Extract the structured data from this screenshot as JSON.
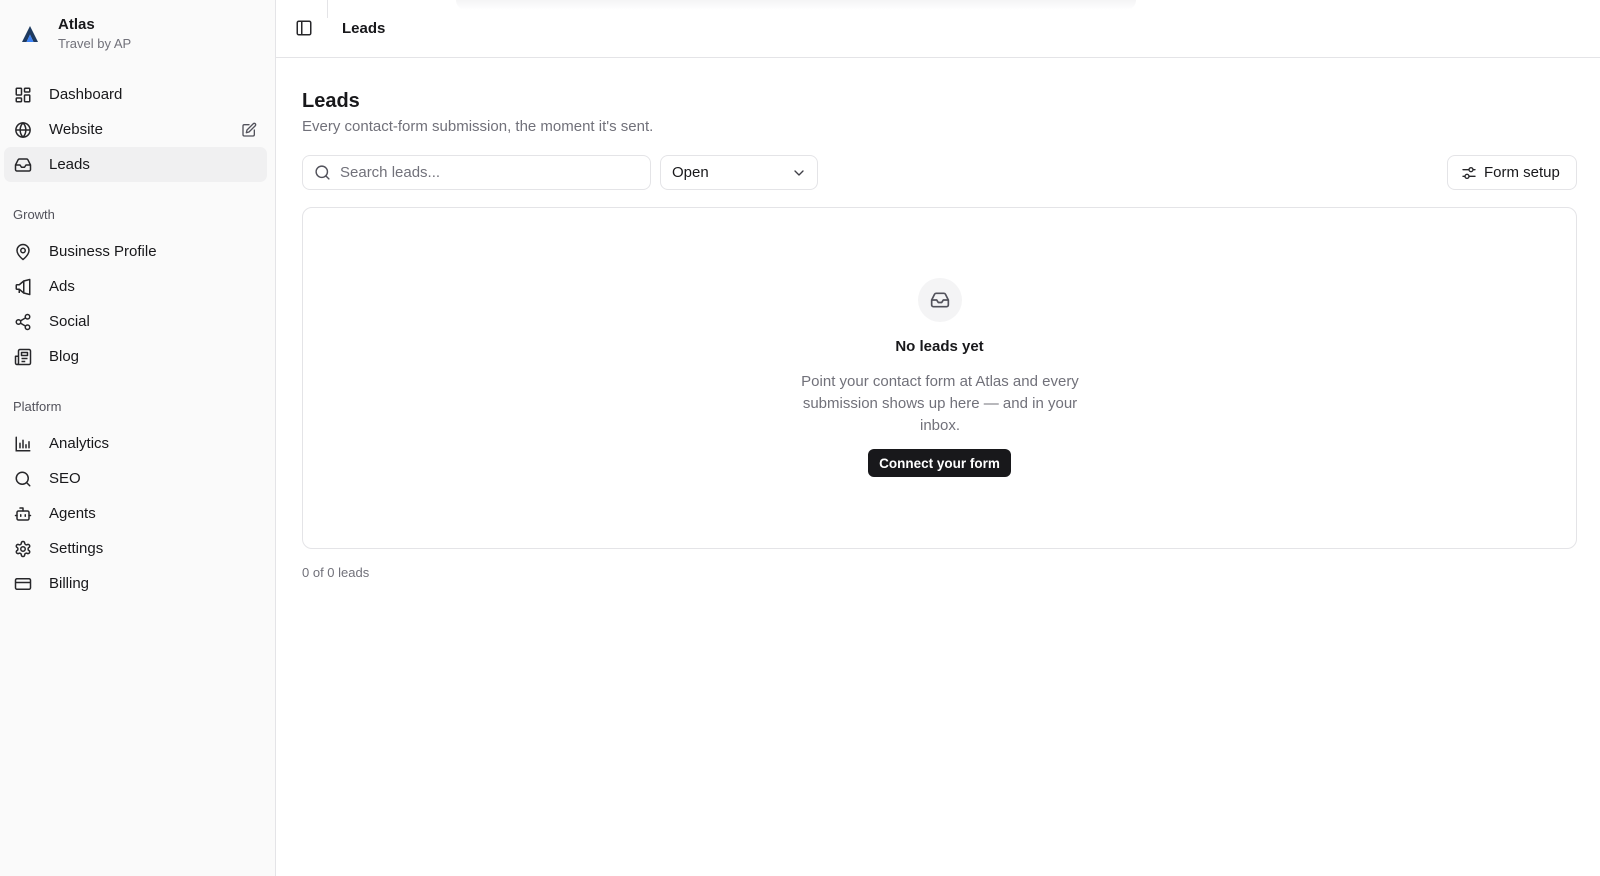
{
  "brand": {
    "name": "Atlas",
    "subtitle": "Travel by AP",
    "logo_icon": "atlas-logo"
  },
  "sidebar": {
    "primary": [
      {
        "label": "Dashboard",
        "icon": "dashboard-icon"
      },
      {
        "label": "Website",
        "icon": "globe-icon",
        "trailing_icon": "edit-icon"
      },
      {
        "label": "Leads",
        "icon": "inbox-icon",
        "active": true
      }
    ],
    "growth_label": "Growth",
    "growth": [
      {
        "label": "Business Profile",
        "icon": "map-pin-icon"
      },
      {
        "label": "Ads",
        "icon": "megaphone-icon"
      },
      {
        "label": "Social",
        "icon": "share-icon"
      },
      {
        "label": "Blog",
        "icon": "newspaper-icon"
      }
    ],
    "platform_label": "Platform",
    "platform": [
      {
        "label": "Analytics",
        "icon": "bar-chart-icon"
      },
      {
        "label": "SEO",
        "icon": "search-icon"
      },
      {
        "label": "Agents",
        "icon": "bot-icon"
      },
      {
        "label": "Settings",
        "icon": "gear-icon"
      },
      {
        "label": "Billing",
        "icon": "credit-card-icon"
      }
    ]
  },
  "topbar": {
    "breadcrumb": "Leads",
    "toggle_icon": "panel-left-icon"
  },
  "main": {
    "title": "Leads",
    "subtitle": "Every contact-form submission, the moment it's sent.",
    "search_placeholder": "Search leads...",
    "filter_value": "Open",
    "form_setup_label": "Form setup",
    "empty": {
      "icon": "inbox-icon",
      "title": "No leads yet",
      "description": "Point your contact form at Atlas and every submission shows up here — and in your inbox.",
      "button_label": "Connect your form"
    },
    "count_text": "0 of 0 leads"
  },
  "colors": {
    "primary": "#18181b",
    "muted_text": "#71717a",
    "border": "#e4e4e7",
    "sidebar_bg": "#fafafa",
    "active_item_bg": "#f0f0f1"
  }
}
